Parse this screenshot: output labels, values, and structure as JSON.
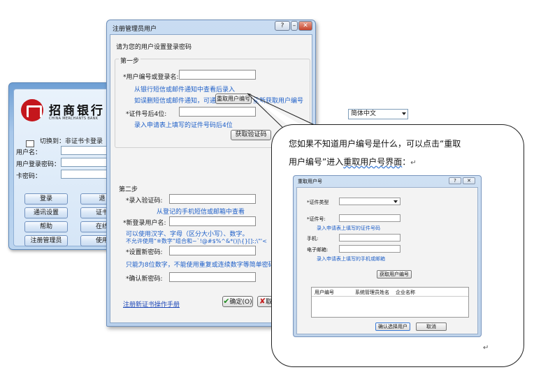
{
  "login_window": {
    "logo_cn": "招商银行",
    "logo_en": "CHINA MERCHANTS BANK",
    "switch_text": "切换到：非证书卡登录",
    "fields": [
      {
        "label": "用户名："
      },
      {
        "label": "用户登录密码："
      },
      {
        "label": "卡密码："
      }
    ],
    "buttons": [
      "登录",
      "退",
      "通讯设置",
      "证书",
      "帮助",
      "在线",
      "注册管理员",
      "使用"
    ]
  },
  "language_select": {
    "value": "简体中文"
  },
  "dialog": {
    "title": "注册管理员用户",
    "help_label": "?",
    "min_label": "–",
    "close_label": "✕",
    "intro": "请为您的用户设置登录密码",
    "step1": {
      "heading": "第一步",
      "user_id_label": "*用户编号或登录名:",
      "hint1": "从银行短信或邮件通知中查看后录入",
      "hint2_prefix": "如误删短信或邮件通知，可通过",
      "reacquire_button": "重取用户编号",
      "hint2_suffix": "重新获取用户编号",
      "cert_label": "*证件号后4位:",
      "cert_hint": "录入申请表上填写的证件号码后4位",
      "get_code_button": "获取验证码"
    },
    "step2": {
      "heading": "第二步",
      "code_label": "*录入验证码:",
      "code_hint": "从登记的手机短信或邮箱中查看",
      "new_login_label": "*新登录用户名:",
      "new_login_hint1": "可以使用汉字、字母（区分大小写）、数字。",
      "new_login_hint2": "不允许使用“※数字”组合和~`!@#$%^&*()|\\{}[]:;\\\"'<",
      "pwd_label": "*设置新密码:",
      "pwd_hint": "只能为8位数字，不能使用重复或连续数字等简单密码。",
      "confirm_label": "*确认新密码:"
    },
    "manual_link": "注册新证书操作手册",
    "ok_button": "确定(O)",
    "cancel_button": "取"
  },
  "callout": {
    "text_line1": "您如果不知道用户编号是什么，可以点击“重取",
    "text_line2_prefix": "用户编号”进入",
    "text_line2_underlined": "重取用户号界面",
    "text_line2_suffix": "：",
    "paragraph_mark": "↵",
    "trailing_mark": "↵",
    "subwindow": {
      "title": "重取用户号",
      "help_label": "?",
      "close_label": "✕",
      "id_type_label": "*证件类型",
      "id_no_label": "*证件号:",
      "id_no_hint": "录入申请表上填写的证件号码",
      "phone_label": "手机:",
      "email_label": "电子邮箱:",
      "email_hint": "录入申请表上填写的手机或邮箱",
      "get_button": "获取用户编号",
      "table_headers": [
        "用户编号",
        "系统管理员姓名",
        "企业名称"
      ],
      "confirm_button": "确认选择用户",
      "cancel_button": "取消"
    }
  }
}
